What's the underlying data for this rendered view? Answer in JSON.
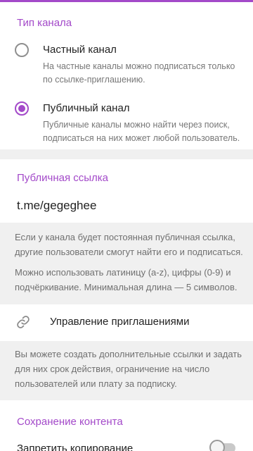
{
  "channel_type": {
    "title": "Тип канала",
    "private": {
      "label": "Частный канал",
      "description": "На частные каналы можно подписаться только по ссылке-приглашению."
    },
    "public": {
      "label": "Публичный канал",
      "description": "Публичные каналы можно найти через поиск, подписаться на них может любой пользователь."
    },
    "selected": "public"
  },
  "public_link": {
    "title": "Публичная ссылка",
    "value": "t.me/gegeghee",
    "info_1": "Если у канала будет постоянная публичная ссылка, другие пользователи смогут найти его и подписаться.",
    "info_2": "Можно использовать латиницу (a-z), цифры (0-9) и подчёркивание. Минимальная длина — 5 символов."
  },
  "invites": {
    "label": "Управление приглашениями",
    "icon": "link-icon",
    "info": "Вы можете создать дополнительные ссылки и задать для них срок действия, ограничение на число пользователей или плату за подписку."
  },
  "content_saving": {
    "title": "Сохранение контента",
    "restrict_copy_label": "Запретить копирование",
    "restrict_copy_enabled": false
  },
  "colors": {
    "accent": "#a349c9",
    "secondary_text": "#777777",
    "background_gray": "#f0f0f0"
  }
}
